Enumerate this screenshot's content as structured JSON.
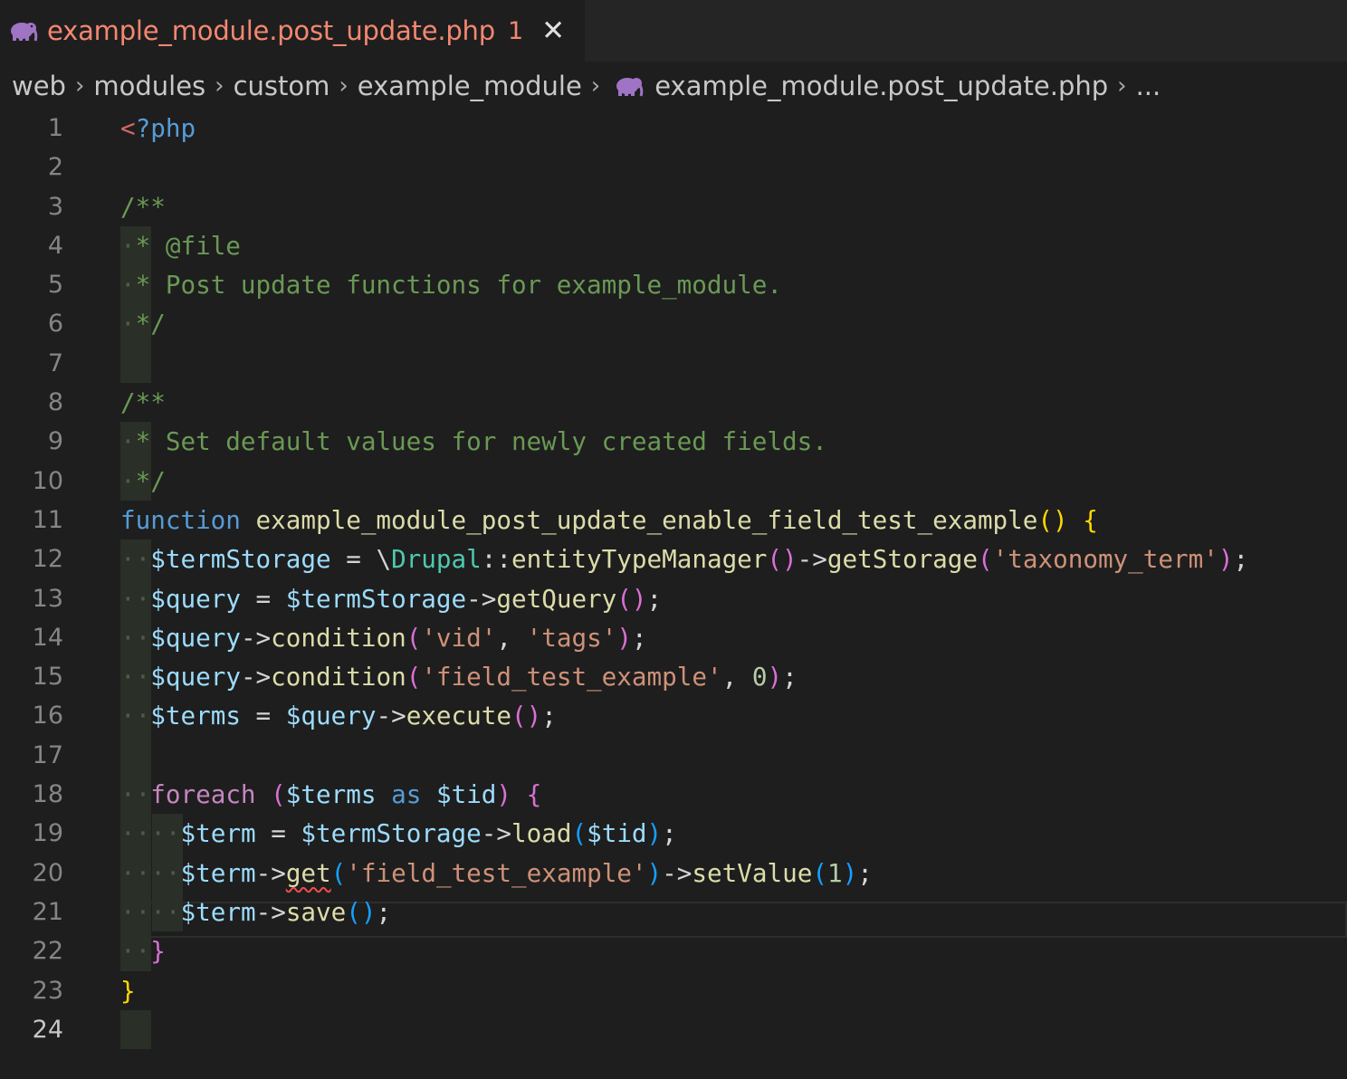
{
  "tab": {
    "title": "example_module.post_update.php",
    "badge": "1",
    "close": "✕",
    "icon": "php-elephant-icon",
    "accent_color": "#f48771"
  },
  "breadcrumb": {
    "items": [
      "web",
      "modules",
      "custom",
      "example_module",
      "example_module.post_update.php",
      "..."
    ],
    "separator": "›"
  },
  "editor": {
    "active_line": 24,
    "lines": [
      {
        "n": "1",
        "text": "<?php"
      },
      {
        "n": "2",
        "text": ""
      },
      {
        "n": "3",
        "text": "/**"
      },
      {
        "n": "4",
        "text": " * @file"
      },
      {
        "n": "5",
        "text": " * Post update functions for example_module."
      },
      {
        "n": "6",
        "text": " */"
      },
      {
        "n": "7",
        "text": ""
      },
      {
        "n": "8",
        "text": "/**"
      },
      {
        "n": "9",
        "text": " * Set default values for newly created fields."
      },
      {
        "n": "10",
        "text": " */"
      },
      {
        "n": "11",
        "text": "function example_module_post_update_enable_field_test_example() {"
      },
      {
        "n": "12",
        "text": "  $termStorage = \\Drupal::entityTypeManager()->getStorage('taxonomy_term');"
      },
      {
        "n": "13",
        "text": "  $query = $termStorage->getQuery();"
      },
      {
        "n": "14",
        "text": "  $query->condition('vid', 'tags');"
      },
      {
        "n": "15",
        "text": "  $query->condition('field_test_example', 0);"
      },
      {
        "n": "16",
        "text": "  $terms = $query->execute();"
      },
      {
        "n": "17",
        "text": ""
      },
      {
        "n": "18",
        "text": "  foreach ($terms as $tid) {"
      },
      {
        "n": "19",
        "text": "    $term = $termStorage->load($tid);"
      },
      {
        "n": "20",
        "text": "    $term->get('field_test_example')->setValue(1);"
      },
      {
        "n": "21",
        "text": "    $term->save();"
      },
      {
        "n": "22",
        "text": "  }"
      },
      {
        "n": "23",
        "text": "}"
      },
      {
        "n": "24",
        "text": ""
      }
    ]
  }
}
